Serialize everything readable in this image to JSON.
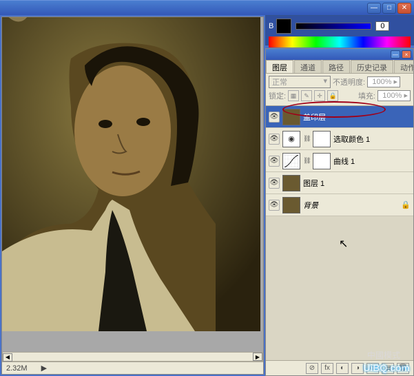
{
  "window": {
    "minimize": "—",
    "maximize": "□",
    "close": "✕"
  },
  "canvas": {
    "status_size": "2.32M",
    "scroll_left": "◀",
    "scroll_right": "▶"
  },
  "color": {
    "channel_label": "B",
    "channel_value": "0"
  },
  "panel_tb": {
    "minimize": "—",
    "close": "×"
  },
  "tabs": {
    "layers": "图层",
    "channels": "通道",
    "paths": "路径",
    "history": "历史记录",
    "actions": "动作"
  },
  "controls": {
    "blend_mode": "正常",
    "opacity_label": "不透明度:",
    "opacity_value": "100%",
    "lock_label": "锁定:",
    "lock_pixels": "▦",
    "lock_paint": "✎",
    "lock_move": "✛",
    "lock_all": "🔒",
    "fill_label": "填充:",
    "fill_value": "100%"
  },
  "layers": [
    {
      "name": "盖印层",
      "thumb": "img",
      "active": true,
      "mask": false,
      "eye": true
    },
    {
      "name": "选取颜色 1",
      "thumb": "adj",
      "active": false,
      "mask": true,
      "eye": true
    },
    {
      "name": "曲线 1",
      "thumb": "curves",
      "active": false,
      "mask": true,
      "eye": true
    },
    {
      "name": "图层 1",
      "thumb": "img",
      "active": false,
      "mask": false,
      "eye": true
    },
    {
      "name": "背景",
      "thumb": "img",
      "active": false,
      "mask": false,
      "eye": true,
      "locked": true,
      "italic": true
    }
  ],
  "footer": {
    "link": "⊘",
    "fx": "fx",
    "mask": "◐",
    "adj": "◑",
    "folder": "▭",
    "new": "▤",
    "trash": "🗑"
  },
  "eye_glyph": "👁",
  "lock_glyph": "🔒",
  "link_glyph": "⛓",
  "watermark": "UiBQ.com",
  "watermark2": "中國模式"
}
